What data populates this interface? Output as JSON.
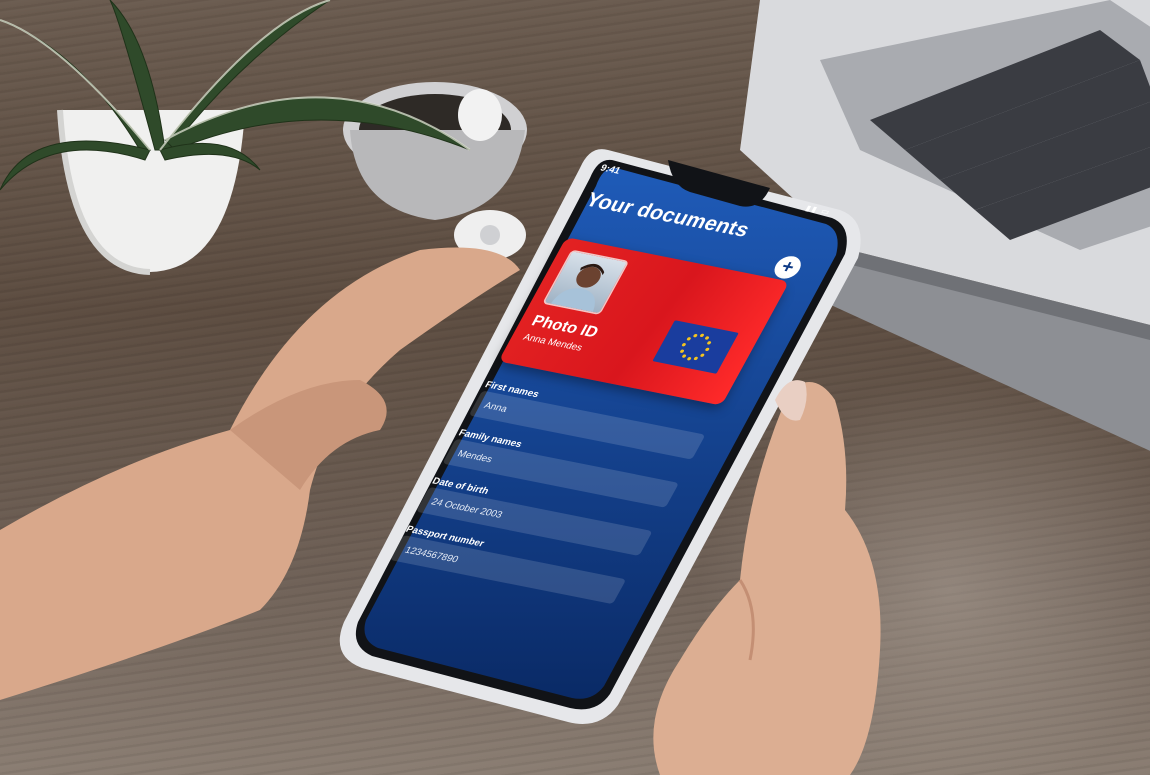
{
  "status": {
    "time": "9:41",
    "icons": "signal-icon battery-icon"
  },
  "screen": {
    "title": "Your documents",
    "add_symbol": "+"
  },
  "card": {
    "title": "Photo ID",
    "name": "Anna Mendes",
    "color": "#e32222",
    "flag_color": "#1a3d9e",
    "star_color": "#f3c321"
  },
  "fields": [
    {
      "label": "First names",
      "value": "Anna"
    },
    {
      "label": "Family names",
      "value": "Mendes"
    },
    {
      "label": "Date of birth",
      "value": "24 October 2003"
    },
    {
      "label": "Passport number",
      "value": "1234567890"
    }
  ],
  "colors": {
    "screen_top": "#1f5bb8",
    "screen_bottom": "#0a2a66"
  }
}
